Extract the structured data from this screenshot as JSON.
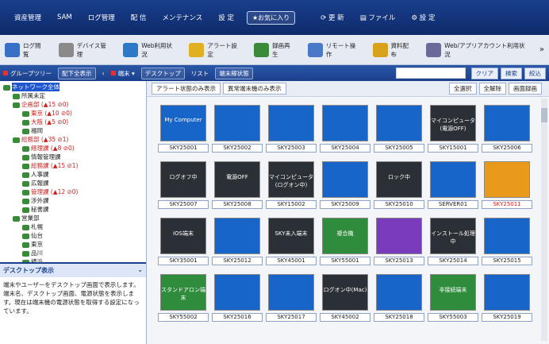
{
  "menubar": {
    "items": [
      "資産管理",
      "SAM",
      "ログ管理",
      "配 信",
      "メンテナンス",
      "設 定"
    ],
    "favorites": "お気に入り",
    "right": [
      "更 新",
      "ファイル",
      "設 定"
    ]
  },
  "toolbar": {
    "buttons": [
      "ログ閲覧",
      "デバイス管理",
      "Web利用状況",
      "アラート設定",
      "録画再生",
      "リモート操作",
      "資料配布",
      "Web/アプリアカウント利用状況"
    ],
    "more": "»"
  },
  "bar2": {
    "group_tree": "グループツリー",
    "show_all": "配下全表示",
    "terminal": "端末",
    "desktop": "デスクトップ",
    "list": "リスト",
    "status": "端末稼状態",
    "search_placeholder": "",
    "clear": "クリア",
    "search": "検索",
    "narrow": "絞込"
  },
  "tree": [
    {
      "t": "ネットワーク全体",
      "sel": true
    },
    {
      "t": "所属未定"
    },
    {
      "t": "企画部 (▲15 ⊘0)",
      "red": true
    },
    {
      "t": "東京 (▲10 ⊘0)",
      "red": true
    },
    {
      "t": "大阪 (▲5 ⊘0)",
      "red": true
    },
    {
      "t": "福岡"
    },
    {
      "t": "総務部 (▲35 ⊘1)",
      "red": true
    },
    {
      "t": "経理課 (▲8 ⊘0)",
      "red": true
    },
    {
      "t": "情報管理課"
    },
    {
      "t": "総務課 (▲15 ⊘1)",
      "red": true
    },
    {
      "t": "人事課"
    },
    {
      "t": "広報課"
    },
    {
      "t": "管理課 (▲12 ⊘0)",
      "red": true
    },
    {
      "t": "涉外課"
    },
    {
      "t": "秘書課"
    },
    {
      "t": "営業部"
    },
    {
      "t": "札幌"
    },
    {
      "t": "仙台"
    },
    {
      "t": "東京"
    },
    {
      "t": "品川"
    },
    {
      "t": "横浜"
    },
    {
      "t": "三島"
    }
  ],
  "desc": {
    "title": "デスクトップ表示",
    "body": "端末やユーザーをデスクトップ画面で表示します。端末名、デスクトップ画面、電源状態を表示します。現在は端末機の電源状態を取得する設定になっています。"
  },
  "filter": {
    "alert_only": "アラート状態のみ表示",
    "abnormal_only": "異常端末機のみ表示",
    "select_all": "全選択",
    "deselect_all": "全解除",
    "record": "画面録画"
  },
  "cards": [
    {
      "name": "SKY25001",
      "text": "My Computer",
      "style": "blue"
    },
    {
      "name": "SKY25002",
      "text": "",
      "style": "blue"
    },
    {
      "name": "SKY25003",
      "text": "",
      "style": "blue"
    },
    {
      "name": "SKY25004",
      "text": "",
      "style": "blue"
    },
    {
      "name": "SKY25005",
      "text": "",
      "style": "blue"
    },
    {
      "name": "SKY15001",
      "text": "マイコンピュータ(電源OFF)",
      "style": "dark"
    },
    {
      "name": "SKY25006",
      "text": "",
      "style": "blue"
    },
    {
      "name": "SKY25007",
      "text": "ログオフ中",
      "style": "dark"
    },
    {
      "name": "SKY25008",
      "text": "電源OFF",
      "style": "dark"
    },
    {
      "name": "SKY15002",
      "text": "マイコンピュータ(ログオン中)",
      "style": "dark"
    },
    {
      "name": "SKY25009",
      "text": "",
      "style": "blue"
    },
    {
      "name": "SKY25010",
      "text": "ロック中",
      "style": "dark"
    },
    {
      "name": "SERVER01",
      "text": "",
      "style": "blue"
    },
    {
      "name": "SKY25011",
      "text": "",
      "style": "orange"
    },
    {
      "name": "SKY35001",
      "text": "iOS端末",
      "style": "dark"
    },
    {
      "name": "SKY25012",
      "text": "",
      "style": "blue"
    },
    {
      "name": "SKY45001",
      "text": "SKY未入端末",
      "style": "dark"
    },
    {
      "name": "SKY55001",
      "text": "複合機",
      "style": "green"
    },
    {
      "name": "SKY25013",
      "text": "",
      "style": "purple"
    },
    {
      "name": "SKY25014",
      "text": "インストール処理中",
      "style": "dark"
    },
    {
      "name": "SKY25015",
      "text": "",
      "style": "blue"
    },
    {
      "name": "SKY55002",
      "text": "スタンドアロン端末",
      "style": "green"
    },
    {
      "name": "SKY25016",
      "text": "",
      "style": "blue"
    },
    {
      "name": "SKY25017",
      "text": "",
      "style": "blue"
    },
    {
      "name": "SKY45002",
      "text": "ログオン中(Mac)",
      "style": "dark"
    },
    {
      "name": "SKY25018",
      "text": "",
      "style": "blue"
    },
    {
      "name": "SKY55003",
      "text": "非接続端末",
      "style": "green"
    },
    {
      "name": "SKY25019",
      "text": "",
      "style": "blue"
    }
  ]
}
